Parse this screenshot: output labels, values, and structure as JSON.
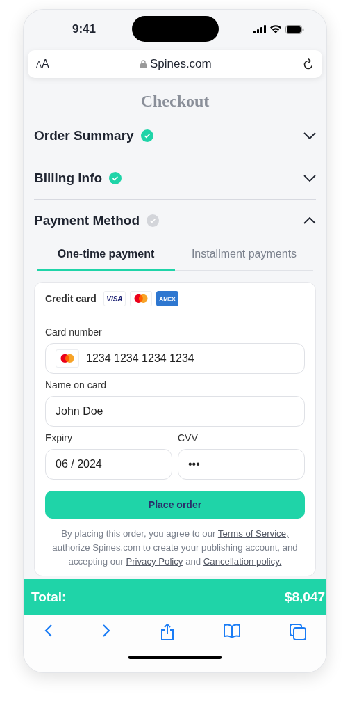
{
  "status_bar": {
    "time": "9:41"
  },
  "browser": {
    "text_size_label": "AA",
    "url": "Spines.com"
  },
  "page_title": "Checkout",
  "sections": [
    {
      "title": "Order Summary",
      "complete": true,
      "expanded": false
    },
    {
      "title": "Billing info",
      "complete": true,
      "expanded": false
    },
    {
      "title": "Payment Method",
      "complete": false,
      "expanded": true
    }
  ],
  "tabs": [
    {
      "label": "One-time payment",
      "selected": true
    },
    {
      "label": "Installment payments",
      "selected": false
    }
  ],
  "payment_card": {
    "label": "Credit card",
    "brands": [
      {
        "kind": "visa",
        "label": "VISA"
      },
      {
        "kind": "mastercard"
      },
      {
        "kind": "amex",
        "label": "AMEX"
      }
    ],
    "fields": [
      {
        "label": "Card number",
        "value": "1234 1234 1234 1234",
        "kind": "card"
      },
      {
        "label": "Name on card",
        "value": "John Doe",
        "kind": "text"
      },
      {
        "label": "Expiry",
        "value": "06 / 2024",
        "kind": "half"
      },
      {
        "label": "CVV",
        "value": "•••",
        "kind": "half"
      }
    ],
    "button": "Place order",
    "terms": [
      {
        "text": "By placing this order, you agree to our ",
        "link": false
      },
      {
        "text": "Terms of Service,",
        "link": true
      },
      {
        "text": " authorize Spines.com to create your publishing account, and accepting our ",
        "link": false
      },
      {
        "text": "Privacy Policy",
        "link": true
      },
      {
        "text": " and ",
        "link": false
      },
      {
        "text": "Cancellation policy.",
        "link": true
      }
    ]
  },
  "total": {
    "label": "Total:",
    "amount": "$8,047"
  }
}
